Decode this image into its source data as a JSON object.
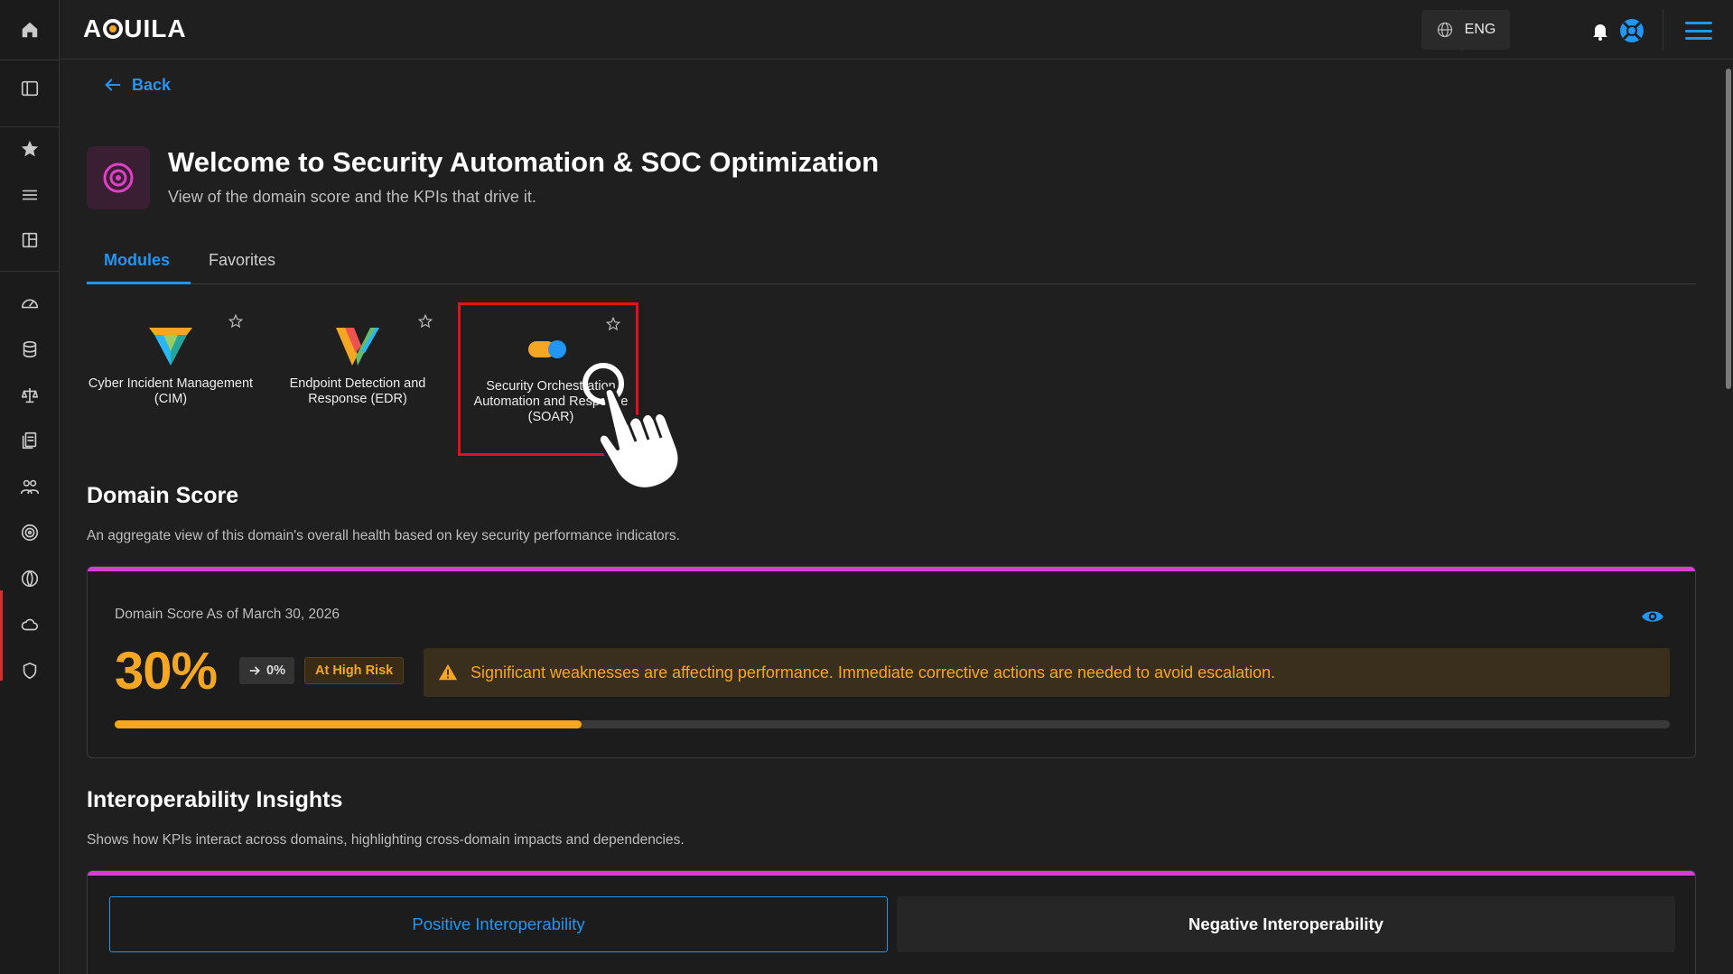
{
  "app": {
    "logo_text": [
      "A",
      "UILA"
    ]
  },
  "topbar": {
    "language": "ENG"
  },
  "nav": {
    "back_label": "Back"
  },
  "header": {
    "title": "Welcome to Security Automation & SOC Optimization",
    "subtitle": "View of the domain score and the KPIs that drive it."
  },
  "tabs": [
    {
      "label": "Modules",
      "active": true
    },
    {
      "label": "Favorites",
      "active": false
    }
  ],
  "modules": [
    {
      "label": "Cyber Incident Management (CIM)",
      "icon": "cim-logo-icon",
      "selected": false
    },
    {
      "label": "Endpoint Detection and Response (EDR)",
      "icon": "edr-logo-icon",
      "selected": false
    },
    {
      "label": "Security Orchestration Automation and Response (SOAR)",
      "icon": "soar-logo-icon",
      "selected": true
    }
  ],
  "domain_score": {
    "title": "Domain Score",
    "subtitle": "An aggregate view of this domain's overall health based on key security performance indicators.",
    "as_of": "Domain Score As of March 30, 2026",
    "value": "30%",
    "progress": 0.3,
    "delta": "0%",
    "risk_badge": "At High Risk",
    "alert": "Significant weaknesses are affecting performance. Immediate corrective actions are needed to avoid escalation."
  },
  "interop": {
    "title": "Interoperability Insights",
    "subtitle": "Shows how KPIs interact across domains, highlighting cross-domain impacts and dependencies.",
    "positive_label": "Positive Interoperability",
    "negative_label": "Negative Interoperability"
  },
  "colors": {
    "accent": "#2196f3",
    "warning": "#f5a623",
    "danger_outline": "#e0121b",
    "card_topline": "#d63fd4"
  }
}
